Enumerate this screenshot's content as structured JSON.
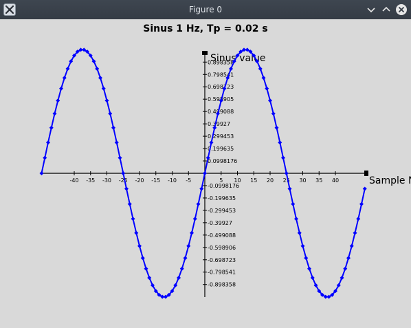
{
  "window": {
    "title": "Figure 0",
    "icon": "x-logo-icon",
    "buttons": [
      "minimize-icon",
      "maximize-icon",
      "close-icon"
    ]
  },
  "chart_data": {
    "type": "line",
    "title": "Sinus 1 Hz, Tp = 0.02 s",
    "xlabel": "Sample N",
    "ylabel": "Sinus value",
    "xlim": [
      -50,
      50
    ],
    "ylim": [
      -1,
      1
    ],
    "grid": false,
    "legend": "none",
    "x_ticks": [
      -40,
      -35,
      -30,
      -25,
      -20,
      -15,
      -10,
      -5,
      5,
      10,
      15,
      20,
      25,
      30,
      35,
      40
    ],
    "y_ticks_positive": [
      "0.898358",
      "0.798541",
      "0.698723",
      "0.598905",
      "0.499088",
      "0.39927",
      "0.299453",
      "0.199635",
      "0.0998176"
    ],
    "y_ticks_negative": [
      "-0.0998176",
      "-0.199635",
      "-0.299453",
      "-0.39927",
      "-0.499088",
      "-0.598906",
      "-0.698723",
      "-0.798541",
      "-0.898358"
    ],
    "series": [
      {
        "color": "#0000ff",
        "marker": "diamond",
        "x_start": -50,
        "x_end": 49,
        "x_step": 1,
        "values": [
          0,
          0.1253,
          0.2487,
          0.3681,
          0.4818,
          0.5878,
          0.6845,
          0.7705,
          0.8443,
          0.9048,
          0.9511,
          0.9823,
          0.998,
          0.998,
          0.9823,
          0.9511,
          0.9048,
          0.8443,
          0.7705,
          0.6845,
          0.5878,
          0.4818,
          0.3681,
          0.2487,
          0.1253,
          0,
          -0.1253,
          -0.2487,
          -0.3681,
          -0.4818,
          -0.5878,
          -0.6845,
          -0.7705,
          -0.8443,
          -0.9048,
          -0.9511,
          -0.9823,
          -0.998,
          -0.998,
          -0.9823,
          -0.9511,
          -0.9048,
          -0.8443,
          -0.7705,
          -0.6845,
          -0.5878,
          -0.4818,
          -0.3681,
          -0.2487,
          -0.1253,
          0,
          0.1253,
          0.2487,
          0.3681,
          0.4818,
          0.5878,
          0.6845,
          0.7705,
          0.8443,
          0.9048,
          0.9511,
          0.9823,
          0.998,
          0.998,
          0.9823,
          0.9511,
          0.9048,
          0.8443,
          0.7705,
          0.6845,
          0.5878,
          0.4818,
          0.3681,
          0.2487,
          0.1253,
          0,
          -0.1253,
          -0.2487,
          -0.3681,
          -0.4818,
          -0.5878,
          -0.6845,
          -0.7705,
          -0.8443,
          -0.9048,
          -0.9511,
          -0.9823,
          -0.998,
          -0.998,
          -0.9823,
          -0.9511,
          -0.9048,
          -0.8443,
          -0.7705,
          -0.6845,
          -0.5878,
          -0.4818,
          -0.3681,
          -0.2487,
          -0.1253
        ]
      }
    ]
  }
}
